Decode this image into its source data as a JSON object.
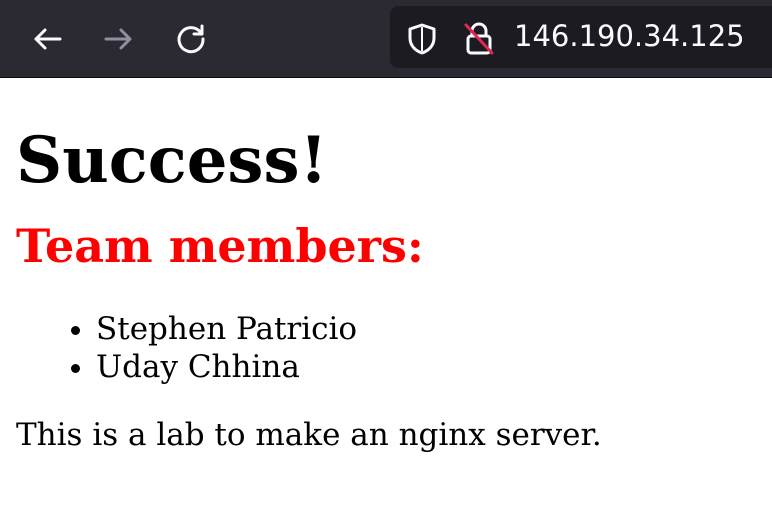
{
  "browser": {
    "url": "146.190.34.125",
    "icons": {
      "back": "back-arrow-icon",
      "forward": "forward-arrow-icon",
      "reload": "reload-icon",
      "shield": "shield-icon",
      "lock": "insecure-lock-icon"
    },
    "colors": {
      "toolbar_bg": "#2b2a33",
      "urlbar_bg": "#1c1b22",
      "icon": "#fbfbfe",
      "icon_disabled": "#8f8f9d",
      "insecure_slash": "#e22850"
    }
  },
  "page": {
    "heading": "Success!",
    "subheading": "Team members:",
    "subheading_color": "#ff0000",
    "team_members": [
      "Stephen Patricio",
      "Uday Chhina"
    ],
    "description": "This is a lab to make an nginx server."
  }
}
